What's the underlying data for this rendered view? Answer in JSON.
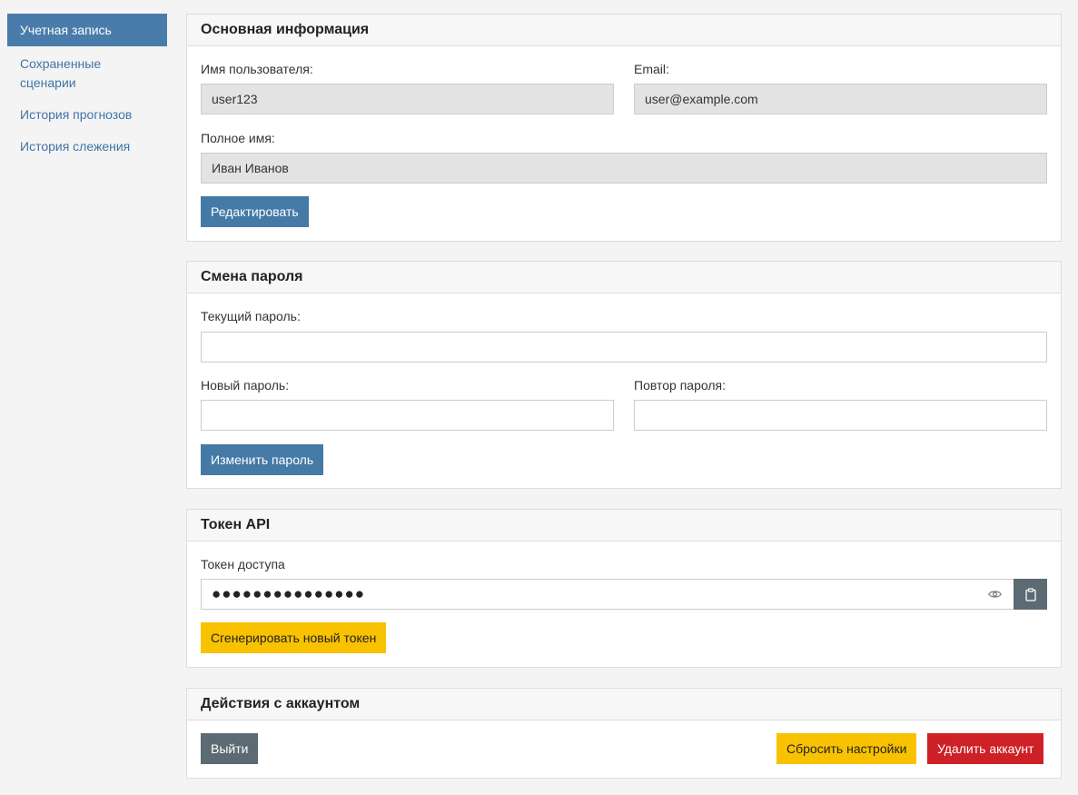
{
  "sidebar": {
    "items": [
      {
        "label": "Учетная запись",
        "active": true
      },
      {
        "label": "Сохраненные сценарии"
      },
      {
        "label": "История прогнозов"
      },
      {
        "label": "История слежения"
      }
    ]
  },
  "basic_info": {
    "title": "Основная информация",
    "username_label": "Имя пользователя:",
    "username_value": "user123",
    "email_label": "Email:",
    "email_value": "user@example.com",
    "fullname_label": "Полное имя:",
    "fullname_value": "Иван Иванов",
    "edit_button": "Редактировать"
  },
  "password": {
    "title": "Смена пароля",
    "current_label": "Текущий пароль:",
    "current_value": "",
    "new_label": "Новый пароль:",
    "new_value": "",
    "repeat_label": "Повтор пароля:",
    "repeat_value": "",
    "change_button": "Изменить пароль"
  },
  "api_token": {
    "title": "Токен API",
    "token_label": "Токен доступа",
    "token_masked": "●●●●●●●●●●●●●●●",
    "show_icon": "eye-icon",
    "copy_icon": "clipboard-icon",
    "generate_button": "Сгенерировать новый токен"
  },
  "account_actions": {
    "title": "Действия с аккаунтом",
    "logout_button": "Выйти",
    "reset_button": "Сбросить настройки",
    "delete_button": "Удалить аккаунт"
  },
  "colors": {
    "primary": "#457aa7",
    "warning": "#f8c200",
    "secondary": "#5b6a73",
    "danger": "#cd2127"
  }
}
